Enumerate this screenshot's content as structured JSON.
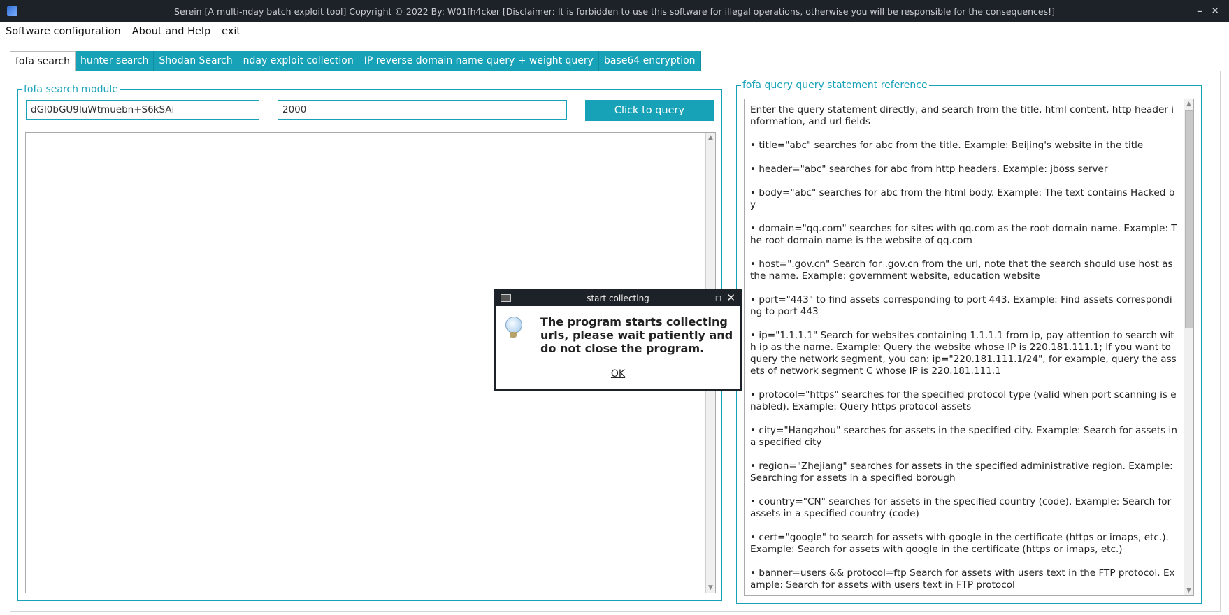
{
  "window": {
    "title": "Serein [A multi-nday batch exploit tool]   Copyright © 2022   By: W01fh4cker   [Disclaimer: It is forbidden to use this software for illegal operations, otherwise you will be responsible for the consequences!]",
    "minimize": "–",
    "close": "✕"
  },
  "menu": [
    {
      "label": "Software configuration"
    },
    {
      "label": "About and Help"
    },
    {
      "label": "exit"
    }
  ],
  "tabs": [
    {
      "label": "fofa search"
    },
    {
      "label": "hunter search"
    },
    {
      "label": "Shodan Search"
    },
    {
      "label": "nday exploit collection"
    },
    {
      "label": "IP reverse domain name query + weight query"
    },
    {
      "label": "base64 encryption"
    }
  ],
  "fofa_module": {
    "legend": "fofa search module",
    "query_value": "dGl0bGU9IuWtmuebn+S6kSAi",
    "count_value": "2000",
    "query_button": "Click to query"
  },
  "reference": {
    "legend": "fofa query query statement reference",
    "lines": [
      "Enter the query statement directly, and search from the title, html content, http header information, and url fields",
      "• title=\"abc\" searches for abc from the title. Example: Beijing's website in the title",
      "• header=\"abc\" searches for abc from http headers. Example: jboss server",
      "• body=\"abc\" searches for abc from the html body. Example: The text contains Hacked by",
      "• domain=\"qq.com\" searches for sites with qq.com as the root domain name. Example: The root domain name is the website of qq.com",
      "• host=\".gov.cn\" Search for .gov.cn from the url, note that the search should use host as the name. Example: government website, education website",
      "• port=\"443\" to find assets corresponding to port 443. Example: Find assets corresponding to port 443",
      "• ip=\"1.1.1.1\" Search for websites containing 1.1.1.1 from ip, pay attention to search with ip as the name. Example: Query the website whose IP is 220.181.111.1; If you want to query the network segment, you can: ip=\"220.181.111.1/24\", for example, query the assets of network segment C whose IP is 220.181.111.1",
      "• protocol=\"https\" searches for the specified protocol type (valid when port scanning is enabled). Example: Query https protocol assets",
      "• city=\"Hangzhou\" searches for assets in the specified city. Example: Search for assets in a specified city",
      "• region=\"Zhejiang\" searches for assets in the specified administrative region. Example: Searching for assets in a specified borough",
      "• country=\"CN\" searches for assets in the specified country (code). Example: Search for assets in a specified country (code)",
      "• cert=\"google\" to search for assets with google in the certificate (https or imaps, etc.). Example: Search for assets with google in the certificate (https or imaps, etc.)",
      "• banner=users && protocol=ftp Search for assets with users text in the FTP protocol. Example: Search for assets with users text in FTP protocol"
    ]
  },
  "dialog": {
    "title": "start collecting",
    "message": "The program starts collecting urls, please wait patiently and do not close the program.",
    "ok": "OK",
    "maximize": "◻",
    "close": "✕"
  },
  "scroll": {
    "result_arrow_up": "▲",
    "result_arrow_down": "▼"
  }
}
